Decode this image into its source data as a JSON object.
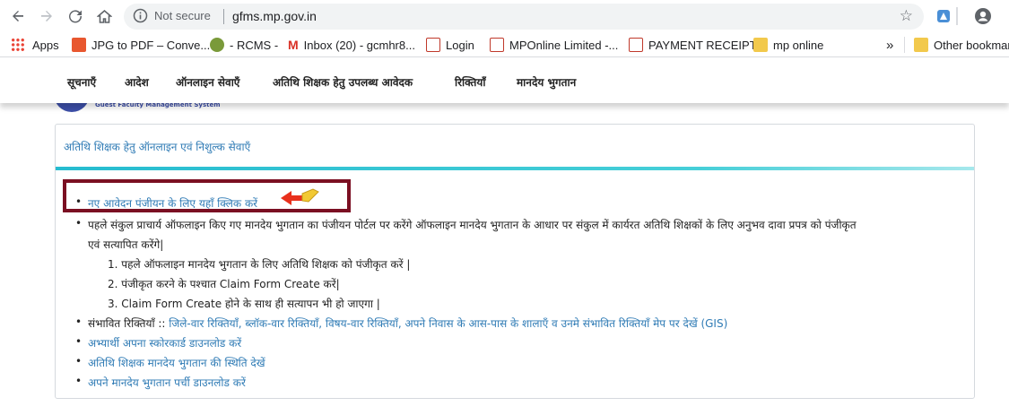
{
  "browser": {
    "status": "Not secure",
    "url": "gfms.mp.gov.in",
    "bookmarks": [
      {
        "label": "Apps",
        "color": "#4285f4"
      },
      {
        "label": "JPG to PDF – Conve...",
        "color": "#e8572f"
      },
      {
        "label": "- RCMS -",
        "color": "#7a9a3a"
      },
      {
        "label": "Inbox (20) - gcmhr8...",
        "color": "#d93025"
      },
      {
        "label": "Login",
        "color": "#c0392b"
      },
      {
        "label": "MPOnline Limited -...",
        "color": "#c0392b"
      },
      {
        "label": "PAYMENT RECEIPT",
        "color": "#c0392b"
      },
      {
        "label": "mp online",
        "color": "#f2c94c"
      },
      {
        "label": "»",
        "color": ""
      },
      {
        "label": "Other bookmar",
        "color": "#f2c94c"
      }
    ]
  },
  "site_menu": [
    "सूचनाएँ",
    "आदेश",
    "ऑनलाइन सेवाएँ",
    "अतिथि शिक्षक हेतु उपलब्ध आवेदक",
    "रिक्तियाँ",
    "मानदेय भुगतान"
  ],
  "logo_text": "Guest Faculty Management System",
  "panel": {
    "title": "अतिथि शिक्षक हेतु ऑनलाइन एवं निशुल्क सेवाएँ",
    "new_registration": "नए आवेदन पंजीयन के लिए यहाँ क्लिक करें",
    "info_line1": "पहले संकुल प्राचार्य ऑफलाइन किए गए मानदेय भुगतान का पंजीयन पोर्टल पर करेंगे ऑफलाइन मानदेय भुगतान के आधार पर संकुल में कार्यरत अतिथि शिक्षकों के लिए अनुभव दावा प्रपत्र को पंजीकृत",
    "info_line2": "एवं सत्यापित करेंगे|",
    "steps": [
      "1. पहले ऑफलाइन मानदेय भुगतान के लिए अतिथि शिक्षक को पंजीकृत करें |",
      "2. पंजीकृत करने के पश्चात Claim Form Create करें|",
      "3. Claim Form Create होने के साथ ही सत्यापन भी हो जाएगा |"
    ],
    "vacancy_prefix": "संभावित रिक्तियाँ :: ",
    "vacancy_links": "जिले-वार रिक्तियाँ, ब्लॉक-वार रिक्तियाँ, विषय-वार रिक्तियाँ, अपने निवास के आस-पास के शालाएँ व उनमे संभावित रिक्तियाँ मेप पर देखें (GIS)",
    "scorecard": "अभ्यार्थी अपना स्कोरकार्ड डाउनलोड करें",
    "payment_status": "अतिथि शिक्षक मानदेय भुगतान की स्थिति देखें",
    "payment_slip": "अपने मानदेय भुगतान पर्ची डाउनलोड करें"
  },
  "colors": {
    "link": "#2f7bb5",
    "highlight": "#7b0f22",
    "rule": "#26bcd0"
  }
}
